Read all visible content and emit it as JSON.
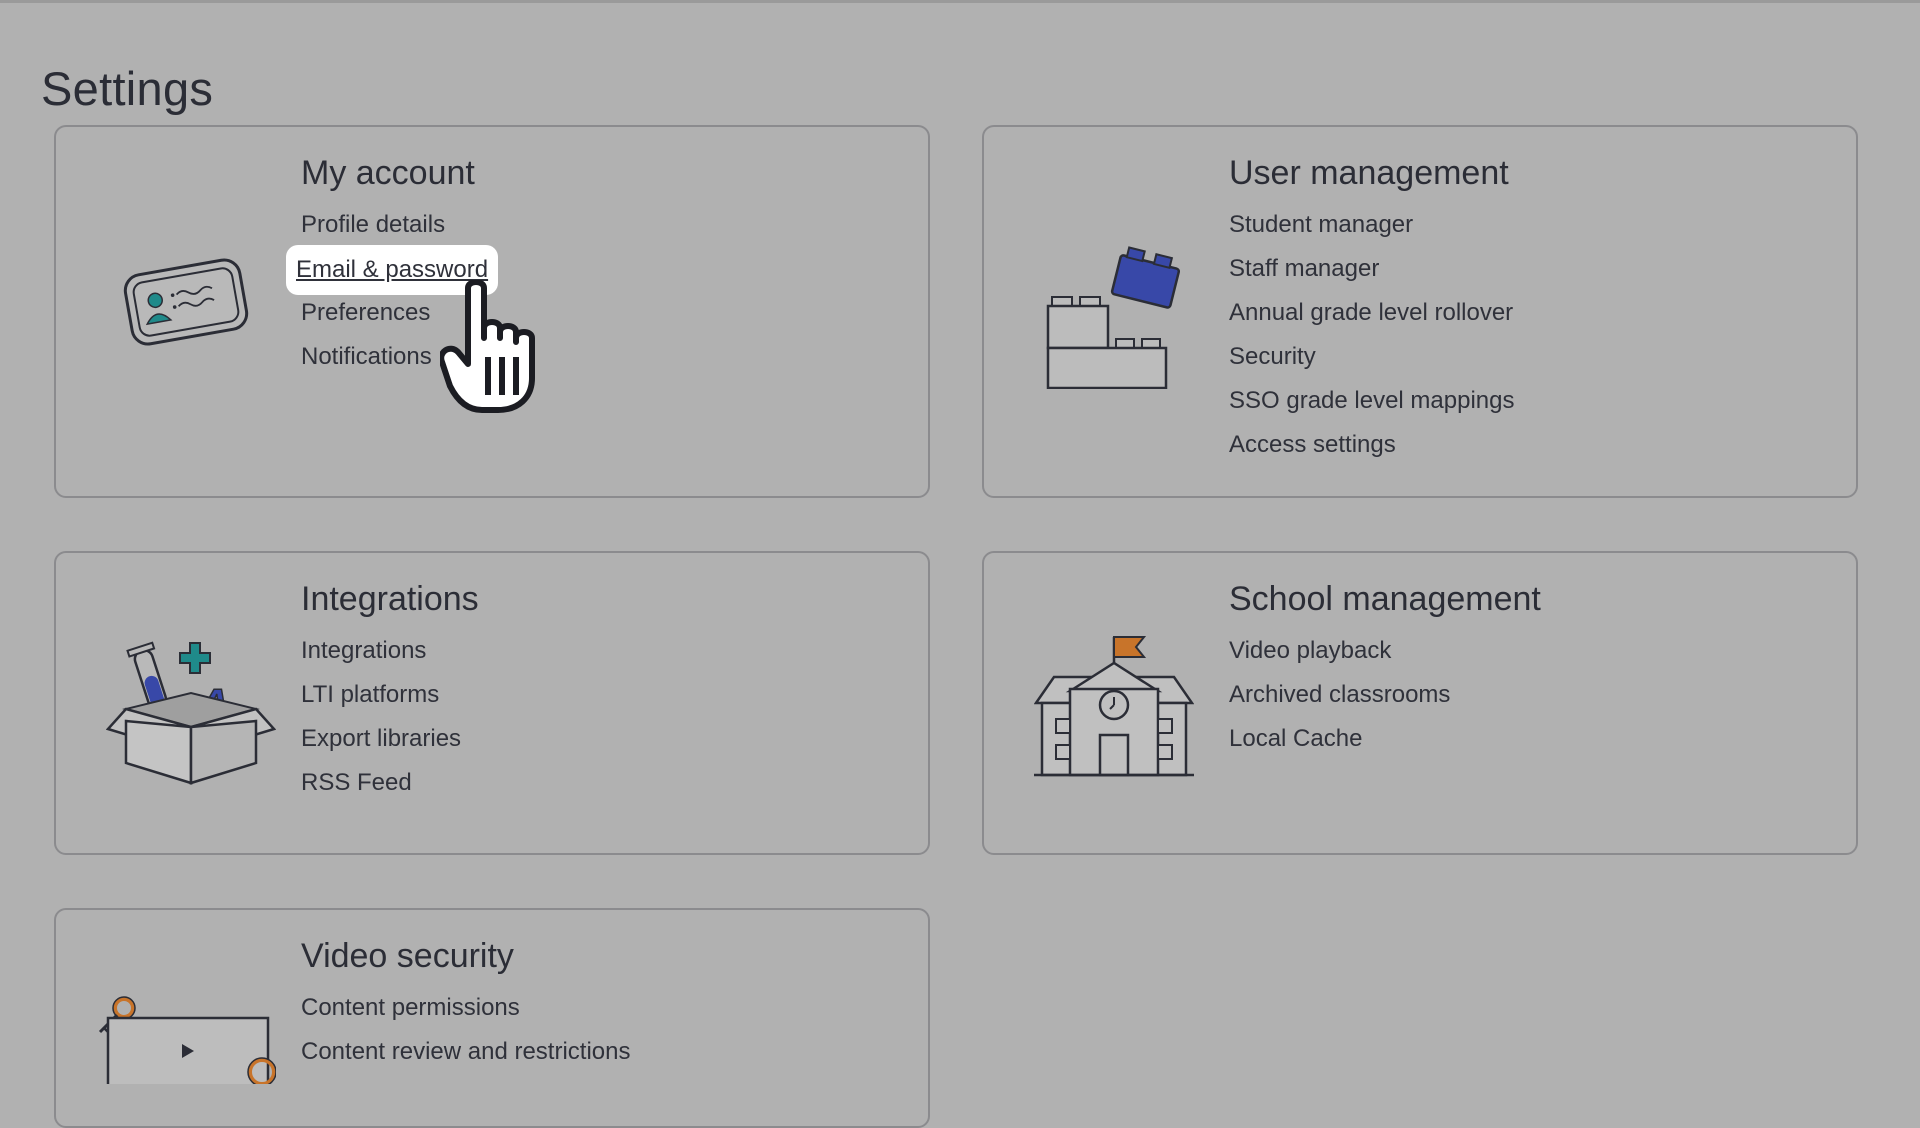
{
  "page": {
    "title": "Settings"
  },
  "cards": {
    "my_account": {
      "title": "My account",
      "icon": "id-card-icon",
      "links": [
        "Profile details",
        "Email & password",
        "Preferences",
        "Notifications"
      ],
      "focused_link": "Email & password"
    },
    "user_management": {
      "title": "User management",
      "icon": "building-blocks-icon",
      "links": [
        "Student manager",
        "Staff manager",
        "Annual grade level rollover",
        "Security",
        "SSO grade level mappings",
        "Access settings"
      ]
    },
    "integrations": {
      "title": "Integrations",
      "icon": "open-box-icon",
      "links": [
        "Integrations",
        "LTI platforms",
        "Export libraries",
        "RSS Feed"
      ]
    },
    "school_management": {
      "title": "School management",
      "icon": "school-building-icon",
      "links": [
        "Video playback",
        "Archived classrooms",
        "Local Cache"
      ]
    },
    "video_security": {
      "title": "Video security",
      "icon": "video-lock-icon",
      "links": [
        "Content permissions",
        "Content review and restrictions"
      ]
    }
  },
  "colors": {
    "background": "#b1b1b1",
    "card_border": "#8b8b8e",
    "text": "#2b2d36",
    "accent_blue": "#3848a8",
    "accent_teal": "#1f8a8a",
    "accent_orange": "#c8742a"
  },
  "cursor": {
    "type": "hand-pointer-icon"
  }
}
